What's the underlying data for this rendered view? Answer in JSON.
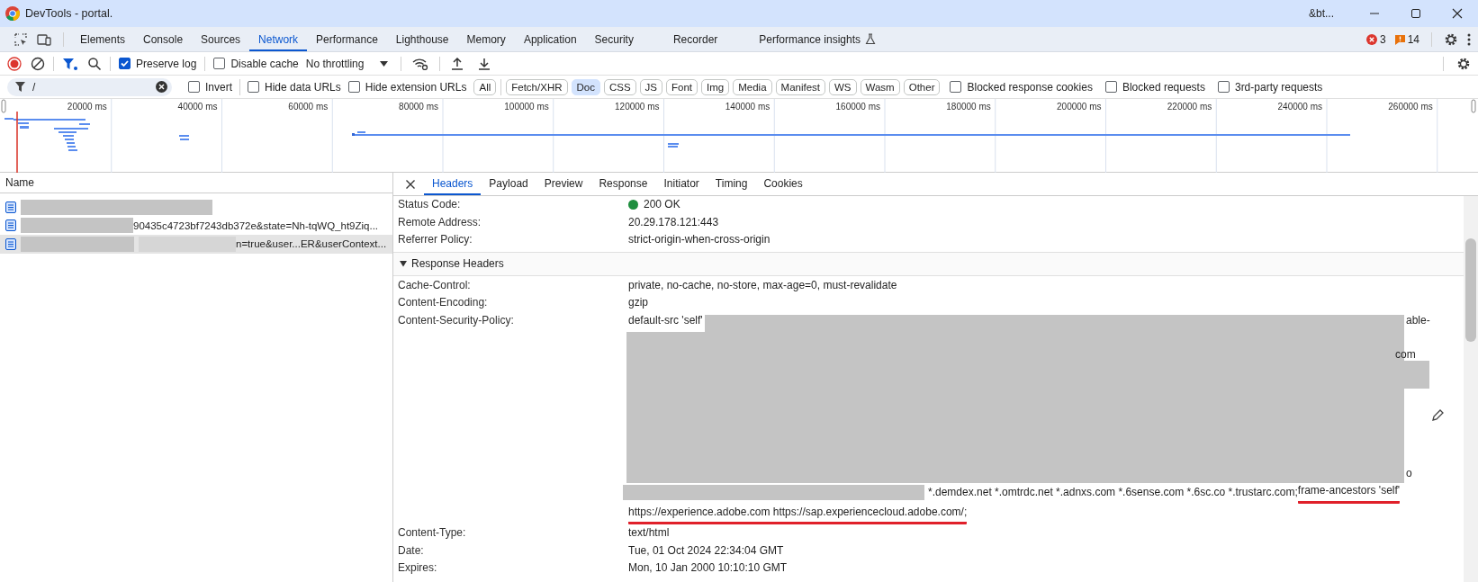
{
  "window": {
    "title": "DevTools - portal.",
    "title_right": "&bt..."
  },
  "panel_tabs": [
    {
      "label": "Elements",
      "selected": false,
      "experimental": false
    },
    {
      "label": "Console",
      "selected": false,
      "experimental": false
    },
    {
      "label": "Sources",
      "selected": false,
      "experimental": false
    },
    {
      "label": "Network",
      "selected": true,
      "experimental": false
    },
    {
      "label": "Performance",
      "selected": false,
      "experimental": false
    },
    {
      "label": "Lighthouse",
      "selected": false,
      "experimental": false
    },
    {
      "label": "Memory",
      "selected": false,
      "experimental": false
    },
    {
      "label": "Application",
      "selected": false,
      "experimental": false
    },
    {
      "label": "Security",
      "selected": false,
      "experimental": false
    },
    {
      "label": "Recorder",
      "selected": false,
      "experimental": false
    },
    {
      "label": "Performance insights",
      "selected": false,
      "experimental": true
    }
  ],
  "issue_counts": {
    "errors": "3",
    "warnings": "14"
  },
  "toolbar": {
    "recording": true,
    "preserve_log": {
      "label": "Preserve log",
      "checked": true
    },
    "disable_cache": {
      "label": "Disable cache",
      "checked": false
    },
    "throttling": "No throttling"
  },
  "filter": {
    "value": "/",
    "options": [
      {
        "label": "Invert",
        "checked": false
      },
      {
        "label": "Hide data URLs",
        "checked": false
      },
      {
        "label": "Hide extension URLs",
        "checked": false
      }
    ],
    "types": [
      {
        "label": "All",
        "selected": false
      },
      {
        "label": "Fetch/XHR",
        "selected": false
      },
      {
        "label": "Doc",
        "selected": true
      },
      {
        "label": "CSS",
        "selected": false
      },
      {
        "label": "JS",
        "selected": false
      },
      {
        "label": "Font",
        "selected": false
      },
      {
        "label": "Img",
        "selected": false
      },
      {
        "label": "Media",
        "selected": false
      },
      {
        "label": "Manifest",
        "selected": false
      },
      {
        "label": "WS",
        "selected": false
      },
      {
        "label": "Wasm",
        "selected": false
      },
      {
        "label": "Other",
        "selected": false
      }
    ],
    "more_options": [
      {
        "label": "Blocked response cookies",
        "checked": false
      },
      {
        "label": "Blocked requests",
        "checked": false
      },
      {
        "label": "3rd-party requests",
        "checked": false
      }
    ]
  },
  "overview": {
    "ticks": [
      "20000 ms",
      "40000 ms",
      "60000 ms",
      "80000 ms",
      "100000 ms",
      "120000 ms",
      "140000 ms",
      "160000 ms",
      "180000 ms",
      "200000 ms",
      "220000 ms",
      "240000 ms",
      "260000 ms"
    ]
  },
  "requests": {
    "column": "Name",
    "rows": [
      {
        "selected": false
      },
      {
        "name": "90435c4723bf7243db372e&state=Nh-tqWQ_ht9Ziq...",
        "selected": false
      },
      {
        "name": "n=true&user...ER&userContext...",
        "selected": true
      }
    ]
  },
  "details": {
    "tabs": [
      {
        "label": "Headers",
        "selected": true
      },
      {
        "label": "Payload",
        "selected": false
      },
      {
        "label": "Preview",
        "selected": false
      },
      {
        "label": "Response",
        "selected": false
      },
      {
        "label": "Initiator",
        "selected": false
      },
      {
        "label": "Timing",
        "selected": false
      },
      {
        "label": "Cookies",
        "selected": false
      }
    ],
    "general": [
      {
        "name": "Status Code:",
        "value": "200 OK",
        "kind": "status"
      },
      {
        "name": "Remote Address:",
        "value": "20.29.178.121:443",
        "kind": "text"
      },
      {
        "name": "Referrer Policy:",
        "value": "strict-origin-when-cross-origin",
        "kind": "text"
      }
    ],
    "response_headers": {
      "title": "Response Headers",
      "expanded": true,
      "rows": [
        {
          "name": "Cache-Control:",
          "value": "private, no-cache, no-store, max-age=0, must-revalidate",
          "kind": "text"
        },
        {
          "name": "Content-Encoding:",
          "value": "gzip",
          "kind": "text"
        },
        {
          "name": "Content-Security-Policy:",
          "kind": "csp",
          "value": "default-src 'self'",
          "fragments": [
            "able-",
            "com",
            "o"
          ],
          "lines": [
            [
              {
                "text": "*.demdex.net *.omtrdc.net *.adnxs.com *.6sense.com *.6sc.co *.trustarc.com;",
                "highlighted": false
              },
              {
                "text": "frame-ancestors 'self'",
                "highlighted": true
              }
            ],
            [
              {
                "text": "https://experience.adobe.com https://sap.experiencecloud.adobe.com/;",
                "highlighted": true
              }
            ]
          ]
        },
        {
          "name": "Content-Type:",
          "value": "text/html",
          "kind": "text"
        },
        {
          "name": "Date:",
          "value": "Tue, 01 Oct 2024 22:34:04 GMT",
          "kind": "text"
        },
        {
          "name": "Expires:",
          "value": "Mon, 10 Jan 2000 10:10:10 GMT",
          "kind": "text"
        }
      ]
    }
  }
}
